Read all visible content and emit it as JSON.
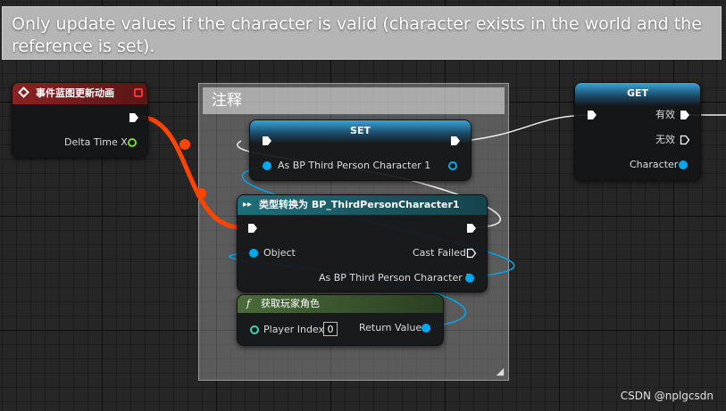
{
  "banner": {
    "text": "Only update values if the character is valid (character exists in the world and the reference is set)."
  },
  "comment": {
    "title": "注释"
  },
  "event_node": {
    "title": "事件蓝图更新动画",
    "delta_label": "Delta Time X",
    "header_color": "#7a1e1e"
  },
  "set_node": {
    "title": "SET",
    "var_label": "As BP Third Person Character 1"
  },
  "cast_node": {
    "title": "类型转换为 BP_ThirdPersonCharacter1",
    "object_label": "Object",
    "cast_failed_label": "Cast Failed",
    "result_label": "As BP Third Person Character 1"
  },
  "get_player_node": {
    "title": "获取玩家角色",
    "player_index_label": "Player Index",
    "player_index_value": "0",
    "return_label": "Return Value"
  },
  "get_node": {
    "title": "GET",
    "valid_label": "有效",
    "invalid_label": "无效",
    "character_label": "Character"
  },
  "watermark": {
    "text": "CSDN @nplgcsdn"
  },
  "colors": {
    "exec_wire": "#ff4400",
    "data_pin": "#00a8f0",
    "float_pin": "#7bd63a"
  }
}
